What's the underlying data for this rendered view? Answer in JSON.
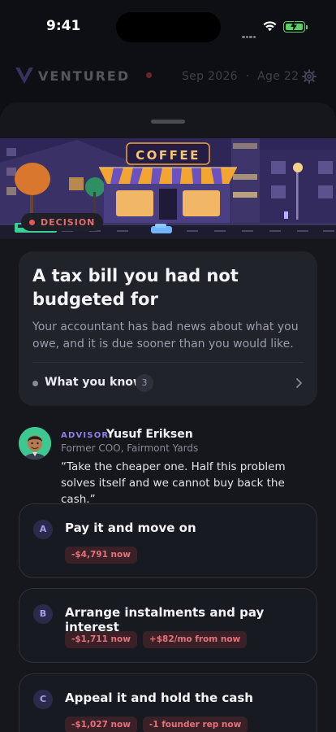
{
  "status_bar": {
    "time": "9:41"
  },
  "app_header": {
    "brand": "VENTURED",
    "date": "Sep 2026",
    "separator": "·",
    "age": "Age 22",
    "brand_color": "#7b6fd6",
    "alert_color": "#ff4b4b"
  },
  "scene": {
    "sign": "COFFEE"
  },
  "badge": {
    "label": "DECISION",
    "color": "#e8555d"
  },
  "event_card": {
    "title": "A tax bill you had not budgeted for",
    "description": "Your accountant has bad news about what you owe, and it is due sooner than you would like.",
    "know_label": "What you know",
    "know_count": "3"
  },
  "advisor": {
    "tag": "ADVISOR",
    "name": "Yusuf Eriksen",
    "role": "Former COO, Fairmont Yards",
    "quote": "“Take the cheaper one. Half this problem solves itself and we cannot buy back the cash.”"
  },
  "options": [
    {
      "letter": "A",
      "title": "Pay it and move on",
      "chips": [
        "-$4,791 now"
      ]
    },
    {
      "letter": "B",
      "title": "Arrange instalments and pay interest",
      "chips": [
        "-$1,711 now",
        "+$82/mo from now"
      ]
    },
    {
      "letter": "C",
      "title": "Appeal it and hold the cash",
      "chips": [
        "-$1,027 now",
        "-1 founder rep now"
      ]
    }
  ],
  "colors": {
    "background": "#0e0f14",
    "sheet": "#16171d",
    "card": "#21232b",
    "accent": "#8f7fe6",
    "negative": "#e6727a"
  }
}
